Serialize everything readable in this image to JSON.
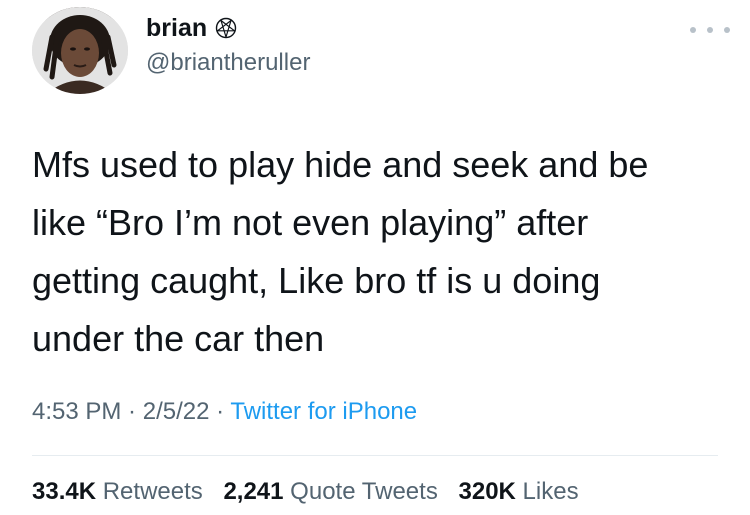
{
  "author": {
    "display_name": "brian",
    "handle": "@briantheruller",
    "badge_icon": "pentagram-icon"
  },
  "tweet": {
    "text": "Mfs used to play hide and seek and be\nlike “Bro I’m not even playing” after\ngetting caught, Like bro tf is u doing\nunder the car then"
  },
  "meta": {
    "time": "4:53 PM",
    "sep1": " · ",
    "date": "2/5/22",
    "sep2": " · ",
    "source": "Twitter for iPhone"
  },
  "stats": {
    "retweets_count": "33.4K",
    "retweets_label": "Retweets",
    "quotes_count": "2,241",
    "quotes_label": "Quote Tweets",
    "likes_count": "320K",
    "likes_label": "Likes"
  },
  "colors": {
    "text": "#0f1419",
    "secondary": "#536471",
    "link": "#1d9bf0"
  }
}
